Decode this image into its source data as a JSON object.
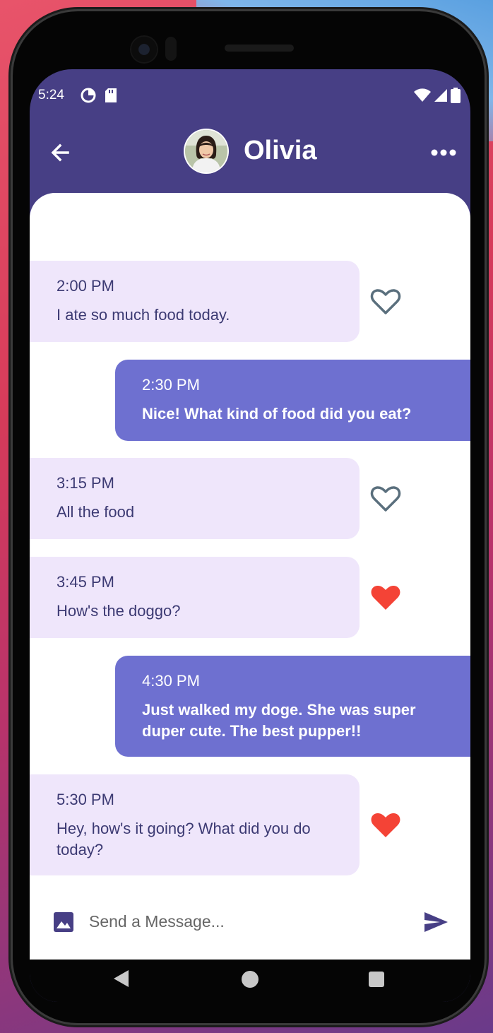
{
  "status_bar": {
    "time": "5:24"
  },
  "header": {
    "contact_name": "Olivia"
  },
  "messages": [
    {
      "time": "2:00 PM",
      "text": "I ate so much food today.",
      "direction": "incoming",
      "liked": false
    },
    {
      "time": "2:30 PM",
      "text": "Nice! What kind of food did you eat?",
      "direction": "outgoing"
    },
    {
      "time": "3:15 PM",
      "text": "All the food",
      "direction": "incoming",
      "liked": false
    },
    {
      "time": "3:45 PM",
      "text": "How's the doggo?",
      "direction": "incoming",
      "liked": true
    },
    {
      "time": "4:30 PM",
      "text": "Just walked my doge. She was super duper cute. The best pupper!!",
      "direction": "outgoing"
    },
    {
      "time": "5:30 PM",
      "text": "Hey, how's it going? What did you do today?",
      "direction": "incoming",
      "liked": true
    }
  ],
  "composer": {
    "placeholder": "Send a Message..."
  },
  "colors": {
    "header_bg": "#473f85",
    "incoming_bubble": "#efe6fb",
    "outgoing_bubble": "#6e70d0",
    "heart_liked": "#f44336",
    "heart_outline": "#5a6f7d"
  },
  "icons": {
    "back": "arrow-left-icon",
    "more": "more-horizontal-icon",
    "heart": "heart-icon",
    "image": "image-icon",
    "send": "send-icon"
  }
}
